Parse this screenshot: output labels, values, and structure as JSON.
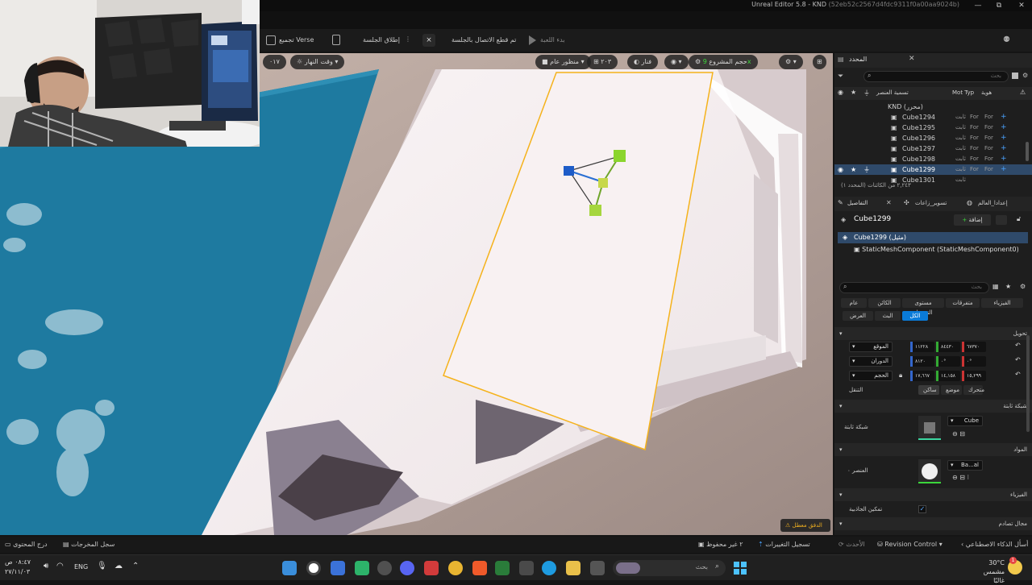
{
  "window": {
    "title": "Unreal Editor 5.8 - KND",
    "hash": "(52eb52c2567d4fdc9311f0a00aa9024b)",
    "minimize": "—",
    "maximize": "⧉",
    "close": "✕"
  },
  "toolbar": {
    "verse": "تجميع Verse",
    "launch_session": "إطلاق الجلسة",
    "disconnected": "تم قطع الاتصال بالجلسة",
    "start_game": "بدء اللعبة"
  },
  "viewport_bar": {
    "time_of_day": "وقت النهار",
    "perspective": "منظور عام",
    "grid_value": "٢٠٣",
    "lit": "فنار",
    "project_size": "حجم المشروع",
    "scale": "٠١٧"
  },
  "viewport": {
    "warning": "الدفق معطل"
  },
  "outliner": {
    "tab": "المحدد",
    "search_placeholder": "بحث",
    "col_label": "تسمية العنصر",
    "col_type": "Mot Typ",
    "col_id": "هوية",
    "root": "KND (محرر)",
    "items": [
      {
        "name": "Cube1294",
        "type": "ثابت",
        "a": "For",
        "b": "For"
      },
      {
        "name": "Cube1295",
        "type": "ثابت",
        "a": "For",
        "b": "For"
      },
      {
        "name": "Cube1296",
        "type": "ثابت",
        "a": "For",
        "b": "For"
      },
      {
        "name": "Cube1297",
        "type": "ثابت",
        "a": "For",
        "b": "For"
      },
      {
        "name": "Cube1298",
        "type": "ثابت",
        "a": "For",
        "b": "For"
      },
      {
        "name": "Cube1299",
        "type": "ثابت",
        "a": "For",
        "b": "For"
      },
      {
        "name": "Cube1301",
        "type": "ثابت",
        "a": "",
        "b": ""
      }
    ],
    "count": "٢,٢٤٣ من الكائنات (المحدد ١)"
  },
  "details": {
    "tabs": [
      "التفاصيل",
      "تسوير_زاعات",
      "إعدادا_العالم"
    ],
    "object_name": "Cube1299",
    "add_button": "إضافة",
    "component_root": "Cube1299 (مثيل)",
    "component_child": "StaticMeshComponent (StaticMeshComponent0)",
    "search_placeholder": "بحث",
    "filters_row1": [
      "الفيزياء",
      "متفرقات",
      "مستوى التفصيل",
      "الكائن",
      "عام"
    ],
    "filters_row2": [
      "الكل",
      "البث",
      "العرض"
    ],
    "transform_section": "تحويل",
    "location_label": "الموقع",
    "rotation_label": "الدوران",
    "scale_label": "الحجم",
    "location": [
      "٦٧٣٧٠",
      "٨٤٤٣٠",
      "١١٢٢٨"
    ],
    "rotation": [
      "٠°",
      "٠°",
      "٨١٢٠"
    ],
    "scale": [
      "١٥,٢٩٩",
      "١٤,١٥٨",
      "١٧,٦٦٧"
    ],
    "mobility_label": "التنقل",
    "mobility_options": [
      "متحرك",
      "موضع",
      "ساكن"
    ],
    "static_mesh_section": "شبكة ثابتة",
    "static_mesh_label": "شبكة ثابتة",
    "static_mesh_value": "Cube",
    "materials_section": "المواد",
    "element_label": "العنصر ٠",
    "material_value": "Ba...al",
    "physics_section": "الفيزياء",
    "gravity_label": "تمكين الجاذبية",
    "collision_section": "مجال تصادم"
  },
  "statusbar": {
    "content_drawer": "درج المحتوى",
    "output_log": "سجل المخرجات",
    "unsaved": "٢ غير محفوظ",
    "changes_log": "تسجيل التغييرات",
    "latest": "الأحدث",
    "revision_control": "Revision Control",
    "ai_questions": "أسأل الذكاء الاصطناعي"
  },
  "taskbar": {
    "time": "٠٨:٤٧ ص",
    "date": "٢٧/١١/٠٣",
    "lang": "ENG",
    "search_placeholder": "بحث",
    "weather_temp": "30°C",
    "weather_desc": "مشمس غالبًا",
    "notif_count": "1"
  },
  "colors": {
    "accent": "#0a7bd8",
    "selection": "#f5b21b",
    "water": "#1e7aa0"
  }
}
